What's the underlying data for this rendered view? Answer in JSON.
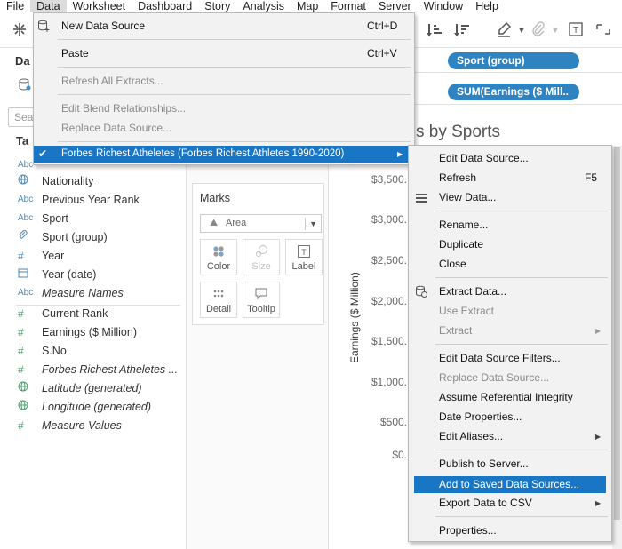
{
  "menubar": {
    "items": [
      "File",
      "Data",
      "Worksheet",
      "Dashboard",
      "Story",
      "Analysis",
      "Map",
      "Format",
      "Server",
      "Window",
      "Help"
    ],
    "active_index": 1
  },
  "data_pane": {
    "tab_label": "Da",
    "search_placeholder": "Sea",
    "tables_label": "Ta",
    "dimensions": [
      {
        "type_icon": "Abc",
        "name": ""
      },
      {
        "type_icon": "globe-icon",
        "name": "Nationality"
      },
      {
        "type_icon": "Abc",
        "name": "Previous Year Rank"
      },
      {
        "type_icon": "Abc",
        "name": "Sport"
      },
      {
        "type_icon": "paperclip-icon",
        "name": "Sport (group)"
      },
      {
        "type_icon": "#",
        "name": "Year"
      },
      {
        "type_icon": "calendar-icon",
        "name": "Year (date)"
      },
      {
        "type_icon": "Abc",
        "name": "Measure Names"
      }
    ],
    "measures": [
      {
        "type_icon": "#",
        "name": "Current Rank"
      },
      {
        "type_icon": "#",
        "name": "Earnings ($ Million)"
      },
      {
        "type_icon": "#",
        "name": "S.No"
      },
      {
        "type_icon": "#",
        "name": "Forbes Richest Atheletes ..."
      },
      {
        "type_icon": "globe-icon",
        "name": "Latitude (generated)"
      },
      {
        "type_icon": "globe-icon",
        "name": "Longitude (generated)"
      },
      {
        "type_icon": "#",
        "name": "Measure Values"
      }
    ]
  },
  "marks": {
    "title": "Marks",
    "mark_type": "Area",
    "buttons": [
      "Color",
      "Size",
      "Label",
      "Detail",
      "Tooltip"
    ]
  },
  "shelves": {
    "columns_pill": "Sport (group)",
    "rows_pill": "SUM(Earnings ($ Mill.."
  },
  "chart": {
    "title_fragment": "s by Sports",
    "y_axis_label": "Earnings ($ Million)",
    "y_ticks": [
      "$3,500.",
      "$3,000.",
      "$2,500.",
      "$2,000.",
      "$1,500.",
      "$1,000.",
      "$500.",
      "$0."
    ]
  },
  "data_menu": {
    "items": [
      {
        "label": "New Data Source",
        "shortcut": "Ctrl+D",
        "disabled": false
      },
      {
        "label": "Paste",
        "shortcut": "Ctrl+V",
        "disabled": false
      },
      {
        "label": "Refresh All Extracts...",
        "shortcut": "",
        "disabled": true
      },
      {
        "label": "Edit Blend Relationships...",
        "shortcut": "",
        "disabled": true
      },
      {
        "label": "Replace Data Source...",
        "shortcut": "",
        "disabled": true
      },
      {
        "label": "Forbes Richest Atheletes (Forbes Richest Athletes 1990-2020)",
        "shortcut": "",
        "disabled": false,
        "checked": true,
        "highlighted": true
      }
    ]
  },
  "datasource_submenu": {
    "items": [
      {
        "label": "Edit Data Source...",
        "shortcut": "",
        "disabled": false
      },
      {
        "label": "Refresh",
        "shortcut": "F5",
        "disabled": false
      },
      {
        "label": "View Data...",
        "shortcut": "",
        "disabled": false
      },
      {
        "label": "Rename...",
        "shortcut": "",
        "disabled": false
      },
      {
        "label": "Duplicate",
        "shortcut": "",
        "disabled": false
      },
      {
        "label": "Close",
        "shortcut": "",
        "disabled": false
      },
      {
        "label": "Extract Data...",
        "shortcut": "",
        "disabled": false
      },
      {
        "label": "Use Extract",
        "shortcut": "",
        "disabled": true
      },
      {
        "label": "Extract",
        "shortcut": "",
        "disabled": true
      },
      {
        "label": "Edit Data Source Filters...",
        "shortcut": "",
        "disabled": false
      },
      {
        "label": "Replace Data Source...",
        "shortcut": "",
        "disabled": true
      },
      {
        "label": "Assume Referential Integrity",
        "shortcut": "",
        "disabled": false
      },
      {
        "label": "Date Properties...",
        "shortcut": "",
        "disabled": false
      },
      {
        "label": "Edit Aliases...",
        "shortcut": "",
        "disabled": false
      },
      {
        "label": "Publish to Server...",
        "shortcut": "",
        "disabled": false
      },
      {
        "label": "Add to Saved Data Sources...",
        "shortcut": "",
        "disabled": false,
        "highlighted": true
      },
      {
        "label": "Export Data to CSV",
        "shortcut": "",
        "disabled": false
      },
      {
        "label": "Properties...",
        "shortcut": "",
        "disabled": false
      }
    ]
  },
  "colors": {
    "pill": "#2f83c1",
    "highlight": "#1976c4",
    "menu_bg": "#f2f2f2"
  }
}
